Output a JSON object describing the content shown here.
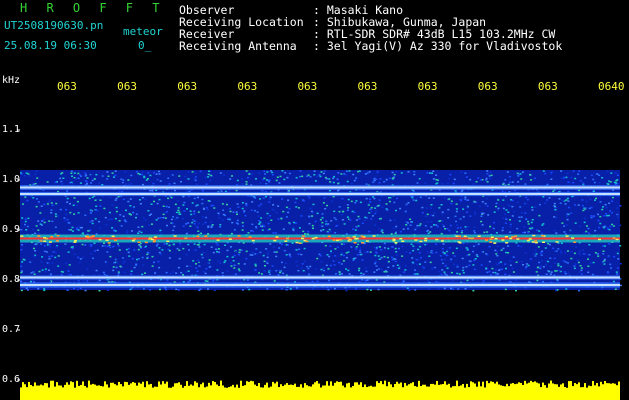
{
  "header": {
    "title": "H R O F F T",
    "file_name": "UT2508190630.pn",
    "mode": "meteor",
    "date_time": "25.08.19 06:30",
    "count": "0_",
    "rows": [
      {
        "label": "Observer",
        "value": ": Masaki Kano"
      },
      {
        "label": "Receiving Location",
        "value": ": Shibukawa, Gunma, Japan"
      },
      {
        "label": "Receiver",
        "value": ": RTL-SDR SDR# 43dB L15 103.2MHz CW"
      },
      {
        "label": "Receiving Antenna",
        "value": ": 3el Yagi(V) Az 330 for Vladivostok"
      }
    ]
  },
  "colors": {
    "background": "#000000",
    "title": "#35d435",
    "info_text": "#20d4d4",
    "header_text": "#ffffff",
    "time_ticks": "#ffff3b",
    "noise_band": "#1030e0",
    "carrier_line": "#ff3030",
    "amplitude_bar": "#ffff00"
  },
  "chart_data": {
    "type": "heatmap",
    "ylabel": "kHz",
    "ylim": [
      0.6,
      1.1
    ],
    "y_ticks": [
      "1.1",
      "1.0",
      "0.9",
      "0.8",
      "0.7",
      "0.6"
    ],
    "x_ticks": [
      "063",
      "063",
      "063",
      "063",
      "063",
      "063",
      "063",
      "063",
      "063",
      "0640"
    ],
    "signal_band_khz": [
      0.78,
      1.02
    ],
    "lines_khz": [
      {
        "freq": 0.985,
        "strength": 0.45
      },
      {
        "freq": 0.972,
        "strength": 0.35
      },
      {
        "freq": 0.883,
        "strength": 1.0
      },
      {
        "freq": 0.805,
        "strength": 0.35
      },
      {
        "freq": 0.79,
        "strength": 0.55
      }
    ],
    "amplitude_level": 0.58
  }
}
